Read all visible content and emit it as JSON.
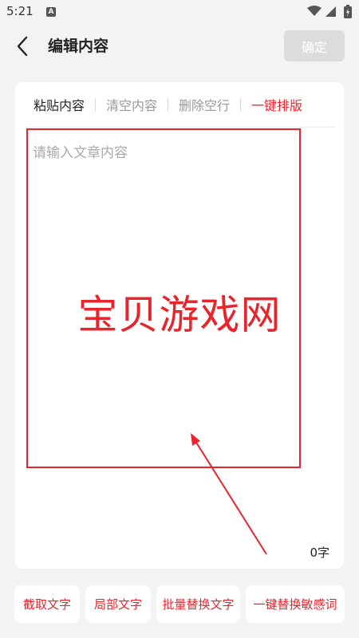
{
  "status_bar": {
    "time": "5:21",
    "notification_badge": "A",
    "icons": [
      "wifi-icon",
      "cell-signal-icon",
      "battery-icon"
    ]
  },
  "header": {
    "title": "编辑内容",
    "confirm_label": "确定",
    "back_icon": "chevron-left-icon"
  },
  "toolbar": {
    "paste_label": "粘贴内容",
    "clear_label": "清空内容",
    "remove_blank_lines_label": "删除空行",
    "auto_format_label": "一键排版"
  },
  "editor": {
    "value": "",
    "placeholder": "请输入文章内容",
    "char_count": "0",
    "char_unit": "字"
  },
  "overlay": {
    "watermark_text": "宝贝游戏网"
  },
  "actions": [
    {
      "label": "截取文字"
    },
    {
      "label": "局部文字"
    },
    {
      "label": "批量替换文字"
    },
    {
      "label": "一键替换敏感词"
    }
  ],
  "colors": {
    "accent": "#e8242c",
    "background": "#f3f3f3",
    "card": "#ffffff",
    "confirm_disabled": "#dcdcdc",
    "muted_text": "#999999"
  }
}
